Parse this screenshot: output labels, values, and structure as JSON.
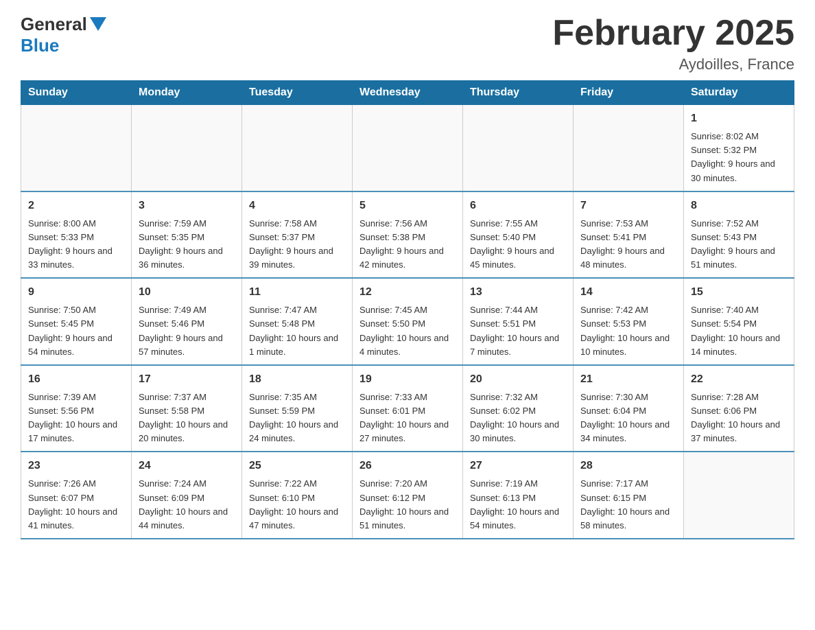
{
  "header": {
    "logo_general": "General",
    "logo_blue": "Blue",
    "month_title": "February 2025",
    "location": "Aydoilles, France"
  },
  "days_of_week": [
    "Sunday",
    "Monday",
    "Tuesday",
    "Wednesday",
    "Thursday",
    "Friday",
    "Saturday"
  ],
  "weeks": [
    [
      {
        "day": "",
        "info": ""
      },
      {
        "day": "",
        "info": ""
      },
      {
        "day": "",
        "info": ""
      },
      {
        "day": "",
        "info": ""
      },
      {
        "day": "",
        "info": ""
      },
      {
        "day": "",
        "info": ""
      },
      {
        "day": "1",
        "info": "Sunrise: 8:02 AM\nSunset: 5:32 PM\nDaylight: 9 hours and 30 minutes."
      }
    ],
    [
      {
        "day": "2",
        "info": "Sunrise: 8:00 AM\nSunset: 5:33 PM\nDaylight: 9 hours and 33 minutes."
      },
      {
        "day": "3",
        "info": "Sunrise: 7:59 AM\nSunset: 5:35 PM\nDaylight: 9 hours and 36 minutes."
      },
      {
        "day": "4",
        "info": "Sunrise: 7:58 AM\nSunset: 5:37 PM\nDaylight: 9 hours and 39 minutes."
      },
      {
        "day": "5",
        "info": "Sunrise: 7:56 AM\nSunset: 5:38 PM\nDaylight: 9 hours and 42 minutes."
      },
      {
        "day": "6",
        "info": "Sunrise: 7:55 AM\nSunset: 5:40 PM\nDaylight: 9 hours and 45 minutes."
      },
      {
        "day": "7",
        "info": "Sunrise: 7:53 AM\nSunset: 5:41 PM\nDaylight: 9 hours and 48 minutes."
      },
      {
        "day": "8",
        "info": "Sunrise: 7:52 AM\nSunset: 5:43 PM\nDaylight: 9 hours and 51 minutes."
      }
    ],
    [
      {
        "day": "9",
        "info": "Sunrise: 7:50 AM\nSunset: 5:45 PM\nDaylight: 9 hours and 54 minutes."
      },
      {
        "day": "10",
        "info": "Sunrise: 7:49 AM\nSunset: 5:46 PM\nDaylight: 9 hours and 57 minutes."
      },
      {
        "day": "11",
        "info": "Sunrise: 7:47 AM\nSunset: 5:48 PM\nDaylight: 10 hours and 1 minute."
      },
      {
        "day": "12",
        "info": "Sunrise: 7:45 AM\nSunset: 5:50 PM\nDaylight: 10 hours and 4 minutes."
      },
      {
        "day": "13",
        "info": "Sunrise: 7:44 AM\nSunset: 5:51 PM\nDaylight: 10 hours and 7 minutes."
      },
      {
        "day": "14",
        "info": "Sunrise: 7:42 AM\nSunset: 5:53 PM\nDaylight: 10 hours and 10 minutes."
      },
      {
        "day": "15",
        "info": "Sunrise: 7:40 AM\nSunset: 5:54 PM\nDaylight: 10 hours and 14 minutes."
      }
    ],
    [
      {
        "day": "16",
        "info": "Sunrise: 7:39 AM\nSunset: 5:56 PM\nDaylight: 10 hours and 17 minutes."
      },
      {
        "day": "17",
        "info": "Sunrise: 7:37 AM\nSunset: 5:58 PM\nDaylight: 10 hours and 20 minutes."
      },
      {
        "day": "18",
        "info": "Sunrise: 7:35 AM\nSunset: 5:59 PM\nDaylight: 10 hours and 24 minutes."
      },
      {
        "day": "19",
        "info": "Sunrise: 7:33 AM\nSunset: 6:01 PM\nDaylight: 10 hours and 27 minutes."
      },
      {
        "day": "20",
        "info": "Sunrise: 7:32 AM\nSunset: 6:02 PM\nDaylight: 10 hours and 30 minutes."
      },
      {
        "day": "21",
        "info": "Sunrise: 7:30 AM\nSunset: 6:04 PM\nDaylight: 10 hours and 34 minutes."
      },
      {
        "day": "22",
        "info": "Sunrise: 7:28 AM\nSunset: 6:06 PM\nDaylight: 10 hours and 37 minutes."
      }
    ],
    [
      {
        "day": "23",
        "info": "Sunrise: 7:26 AM\nSunset: 6:07 PM\nDaylight: 10 hours and 41 minutes."
      },
      {
        "day": "24",
        "info": "Sunrise: 7:24 AM\nSunset: 6:09 PM\nDaylight: 10 hours and 44 minutes."
      },
      {
        "day": "25",
        "info": "Sunrise: 7:22 AM\nSunset: 6:10 PM\nDaylight: 10 hours and 47 minutes."
      },
      {
        "day": "26",
        "info": "Sunrise: 7:20 AM\nSunset: 6:12 PM\nDaylight: 10 hours and 51 minutes."
      },
      {
        "day": "27",
        "info": "Sunrise: 7:19 AM\nSunset: 6:13 PM\nDaylight: 10 hours and 54 minutes."
      },
      {
        "day": "28",
        "info": "Sunrise: 7:17 AM\nSunset: 6:15 PM\nDaylight: 10 hours and 58 minutes."
      },
      {
        "day": "",
        "info": ""
      }
    ]
  ]
}
